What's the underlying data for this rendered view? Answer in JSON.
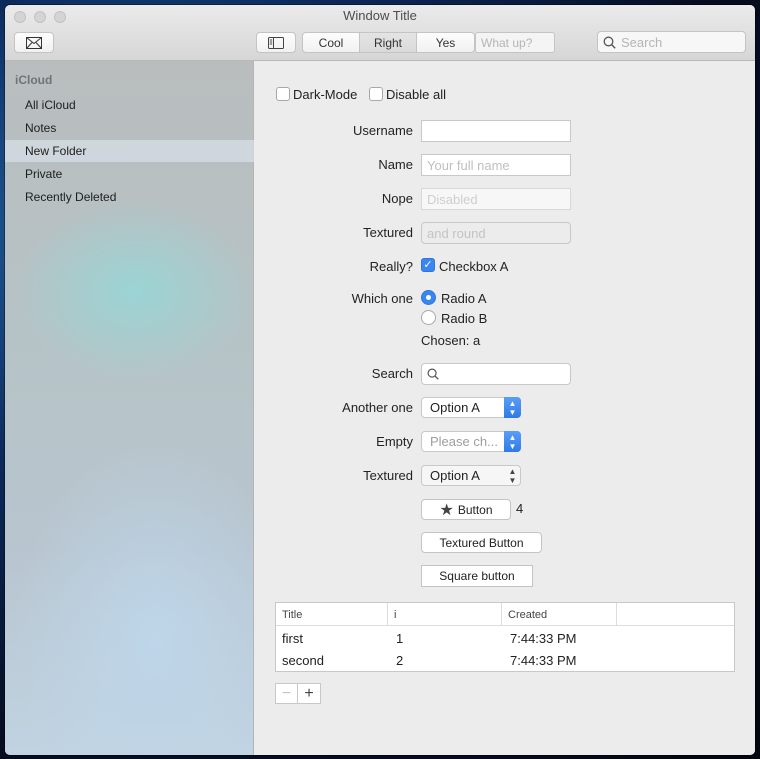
{
  "window": {
    "title": "Window Title"
  },
  "toolbar": {
    "mail_icon": "envelope-icon",
    "sidebar_icon": "sidebar-toggle-icon",
    "segments": [
      "Cool",
      "Right",
      "Yes"
    ],
    "selected_segment": "Right",
    "what_up_placeholder": "What up?",
    "search_placeholder": "Search"
  },
  "sidebar": {
    "header": "iCloud",
    "items": [
      {
        "label": "All iCloud"
      },
      {
        "label": "Notes"
      },
      {
        "label": "New Folder",
        "selected": true
      },
      {
        "label": "Private"
      },
      {
        "label": "Recently Deleted"
      }
    ]
  },
  "form": {
    "dark_mode_label": "Dark-Mode",
    "disable_all_label": "Disable all",
    "username_label": "Username",
    "username_value": "",
    "name_label": "Name",
    "name_placeholder": "Your full name",
    "nope_label": "Nope",
    "nope_placeholder": "Disabled",
    "textured_label": "Textured",
    "textured_placeholder": "and round",
    "really_label": "Really?",
    "checkbox_a_label": "Checkbox A",
    "checkbox_a_checked": true,
    "which_one_label": "Which one",
    "radio_a_label": "Radio A",
    "radio_b_label": "Radio B",
    "chosen_text": "Chosen: a",
    "search_label": "Search",
    "another_one_label": "Another one",
    "another_one_value": "Option A",
    "empty_label": "Empty",
    "empty_placeholder": "Please ch...",
    "textured_popup_label": "Textured",
    "textured_popup_value": "Option A",
    "star_button_label": "Button",
    "star_count": "4",
    "textured_button_label": "Textured Button",
    "square_button_label": "Square button"
  },
  "table": {
    "columns": [
      "Title",
      "i",
      "Created"
    ],
    "rows": [
      [
        "first",
        "1",
        "7:44:33 PM"
      ],
      [
        "second",
        "2",
        "7:44:33 PM"
      ]
    ]
  },
  "table_controls": {
    "minus": "−",
    "plus": "+"
  },
  "colors": {
    "accent": "#3a86f0",
    "window_bg": "#ececec"
  }
}
